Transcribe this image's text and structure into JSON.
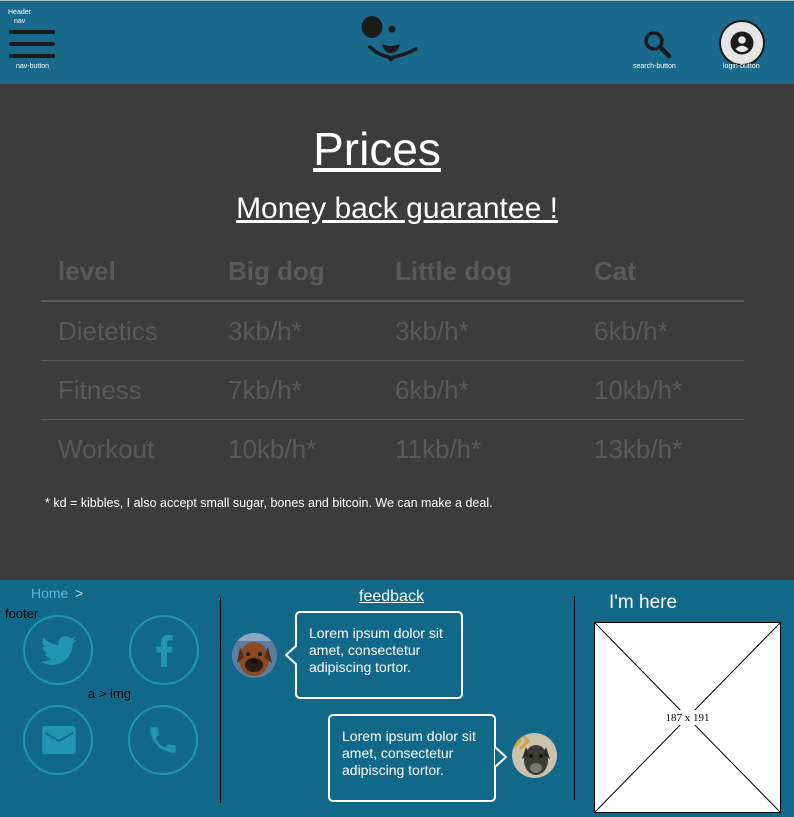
{
  "header": {
    "tag_header": "Header",
    "tag_nav": "nav",
    "nav_button_label": "nav-button",
    "search_button_label": "search-button",
    "login_button_label": "login-button",
    "logo_icon": "dog-face-logo",
    "colors": {
      "background": "#1a6a8e",
      "icons": "#1b1b1b"
    }
  },
  "main": {
    "title": "Prices",
    "subtitle": "Money back guarantee !",
    "table": {
      "headers": [
        "level",
        "Big dog",
        "Little dog",
        "Cat"
      ],
      "rows": [
        [
          "Dietetics",
          "3kb/h*",
          "3kb/h*",
          "6kb/h*"
        ],
        [
          "Fitness",
          "7kb/h*",
          "6kb/h*",
          "10kb/h*"
        ],
        [
          "Workout",
          "10kb/h*",
          "11kb/h*",
          "13kb/h*"
        ]
      ]
    },
    "note": "* kd = kibbles, I also accept small sugar, bones and bitcoin. We can make a deal."
  },
  "footer": {
    "breadcrumb_home": "Home",
    "breadcrumb_sep": ">",
    "tag_footer": "footer",
    "tag_a_img": "a > img",
    "social_icons": [
      "twitter-icon",
      "facebook-icon",
      "mail-icon",
      "phone-icon"
    ],
    "feedback_title": "feedback",
    "feedback": [
      {
        "text": "Lorem ipsum dolor sit amet, consectetur adipiscing tortor."
      },
      {
        "text": "Lorem ipsum dolor sit amet, consectetur adipiscing tortor."
      }
    ],
    "location_title": "I'm here",
    "map_placeholder": "187 x 191",
    "colors": {
      "background": "#126889",
      "link": "#5fb7d6",
      "social_border": "#2196b0"
    }
  }
}
